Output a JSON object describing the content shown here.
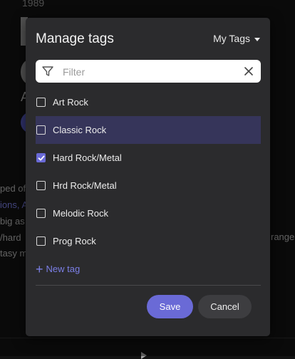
{
  "background": {
    "year": "1989",
    "heading_letter": "A",
    "lines": [
      "ped of",
      "ions, A",
      "big as",
      "/hard",
      "tasy m"
    ],
    "right_text": "range"
  },
  "modal": {
    "title": "Manage tags",
    "dropdown_label": "My Tags",
    "filter": {
      "placeholder": "Filter",
      "value": ""
    },
    "tags": [
      {
        "label": "Art Rock",
        "checked": false,
        "highlighted": false
      },
      {
        "label": "Classic Rock",
        "checked": false,
        "highlighted": true
      },
      {
        "label": "Hard Rock/Metal",
        "checked": true,
        "highlighted": false
      },
      {
        "label": "Hrd Rock/Metal",
        "checked": false,
        "highlighted": false
      },
      {
        "label": "Melodic Rock",
        "checked": false,
        "highlighted": false
      },
      {
        "label": "Prog Rock",
        "checked": false,
        "highlighted": false
      }
    ],
    "new_tag_label": "New tag",
    "save_label": "Save",
    "cancel_label": "Cancel"
  },
  "colors": {
    "accent": "#6a6ad6",
    "link": "#7b7fe6",
    "modal_bg": "#2b2b2d",
    "highlight_row": "#36355a"
  }
}
